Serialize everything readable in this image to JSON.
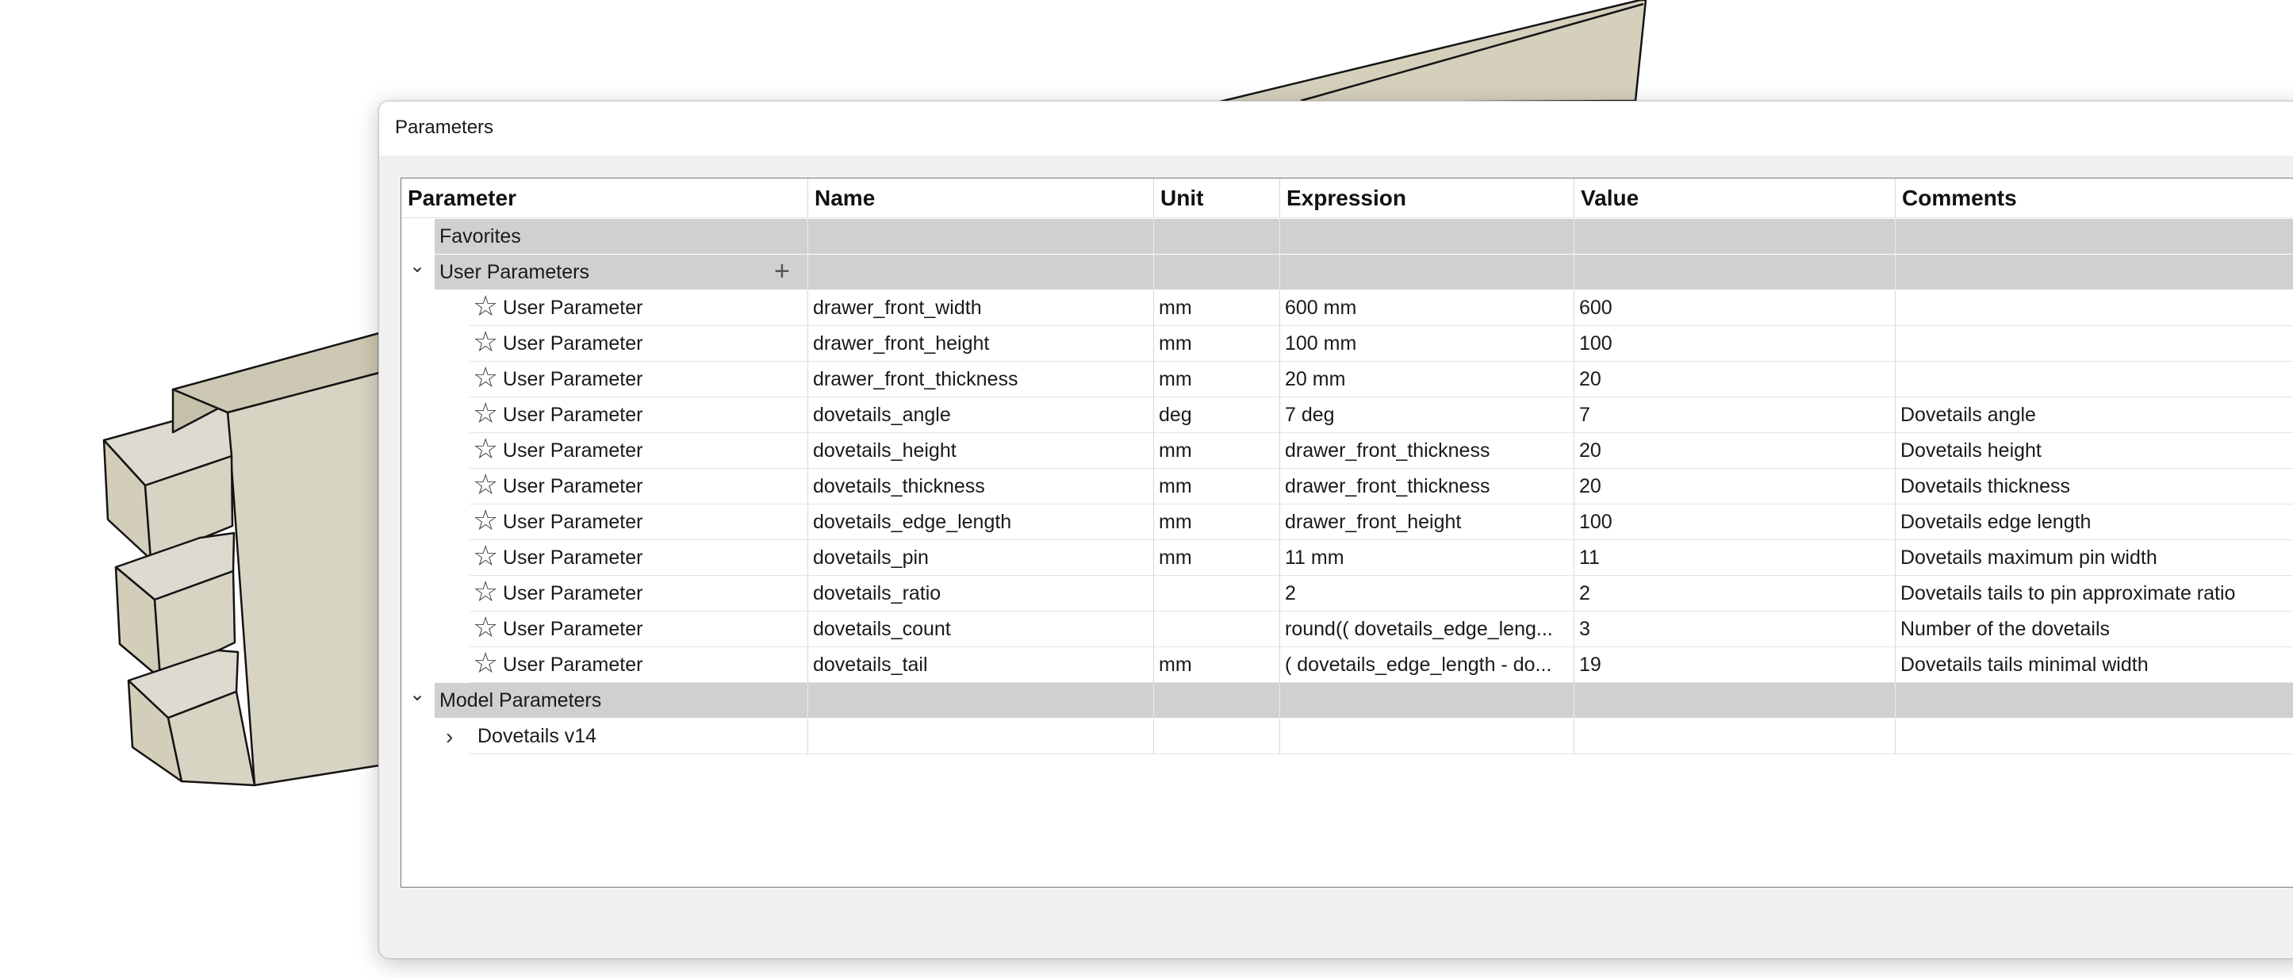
{
  "dialog": {
    "title": "Parameters"
  },
  "table": {
    "headers": [
      "Parameter",
      "Name",
      "Unit",
      "Expression",
      "Value",
      "Comments"
    ],
    "groups": {
      "favorites": "Favorites",
      "user": "User Parameters",
      "model": "Model Parameters"
    },
    "user_rows": [
      {
        "param": "User Parameter",
        "name": "drawer_front_width",
        "unit": "mm",
        "expression": "600 mm",
        "value": "600",
        "comment": ""
      },
      {
        "param": "User Parameter",
        "name": "drawer_front_height",
        "unit": "mm",
        "expression": "100 mm",
        "value": "100",
        "comment": ""
      },
      {
        "param": "User Parameter",
        "name": "drawer_front_thickness",
        "unit": "mm",
        "expression": "20 mm",
        "value": "20",
        "comment": ""
      },
      {
        "param": "User Parameter",
        "name": "dovetails_angle",
        "unit": "deg",
        "expression": "7 deg",
        "value": "7",
        "comment": "Dovetails angle"
      },
      {
        "param": "User Parameter",
        "name": "dovetails_height",
        "unit": "mm",
        "expression": "drawer_front_thickness",
        "value": "20",
        "comment": "Dovetails height"
      },
      {
        "param": "User Parameter",
        "name": "dovetails_thickness",
        "unit": "mm",
        "expression": "drawer_front_thickness",
        "value": "20",
        "comment": "Dovetails thickness"
      },
      {
        "param": "User Parameter",
        "name": "dovetails_edge_length",
        "unit": "mm",
        "expression": "drawer_front_height",
        "value": "100",
        "comment": "Dovetails edge length"
      },
      {
        "param": "User Parameter",
        "name": "dovetails_pin",
        "unit": "mm",
        "expression": "11 mm",
        "value": "11",
        "comment": "Dovetails maximum pin width"
      },
      {
        "param": "User Parameter",
        "name": "dovetails_ratio",
        "unit": "",
        "expression": "2",
        "value": "2",
        "comment": "Dovetails tails to pin approximate ratio"
      },
      {
        "param": "User Parameter",
        "name": "dovetails_count",
        "unit": "",
        "expression": "round(( dovetails_edge_leng...",
        "value": "3",
        "comment": "Number of the dovetails"
      },
      {
        "param": "User Parameter",
        "name": "dovetails_tail",
        "unit": "mm",
        "expression": "( dovetails_edge_length - do...",
        "value": "19",
        "comment": "Dovetails tails minimal width"
      }
    ],
    "model_rows": [
      {
        "label": "Dovetails v14"
      }
    ]
  },
  "icons": {
    "expanded": "chevron-down-icon",
    "collapsed": "chevron-right-icon",
    "favorite": "star-outline-icon",
    "add": "plus-icon"
  },
  "colors": {
    "group_row": "#d0d0d0",
    "model_face": "#d6d2c0",
    "model_edge": "#111111"
  }
}
